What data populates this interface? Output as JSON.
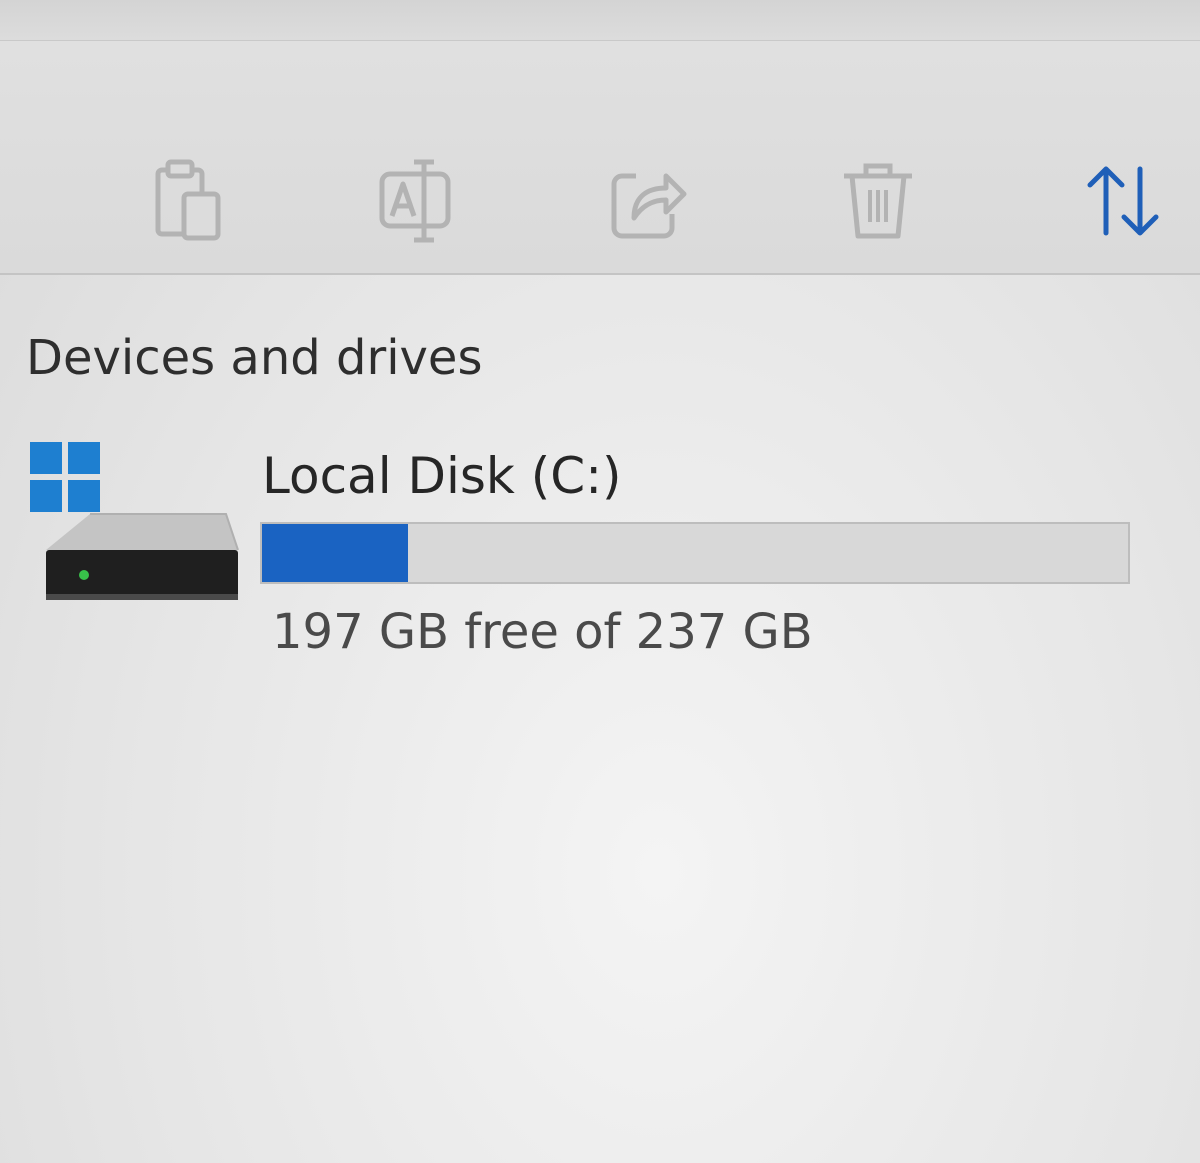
{
  "toolbar": {
    "buttons": [
      {
        "name": "paste",
        "icon": "paste-icon",
        "enabled": false
      },
      {
        "name": "rename",
        "icon": "rename-icon",
        "enabled": false
      },
      {
        "name": "share",
        "icon": "share-icon",
        "enabled": false
      },
      {
        "name": "delete",
        "icon": "trash-icon",
        "enabled": false
      },
      {
        "name": "sort",
        "icon": "sort-icon",
        "enabled": true
      }
    ],
    "disabled_color": "#b3b3b3",
    "accent_color": "#1f5fb8"
  },
  "section": {
    "title": "Devices and drives"
  },
  "drives": [
    {
      "name": "Local Disk (C:)",
      "capacity_text": "197 GB free of 237 GB",
      "free_gb": 197,
      "total_gb": 237,
      "used_fraction": 0.169,
      "icon": "windows-drive-icon",
      "bar_color": "#1a63c2",
      "bar_track_color": "#d8d8d8"
    }
  ]
}
